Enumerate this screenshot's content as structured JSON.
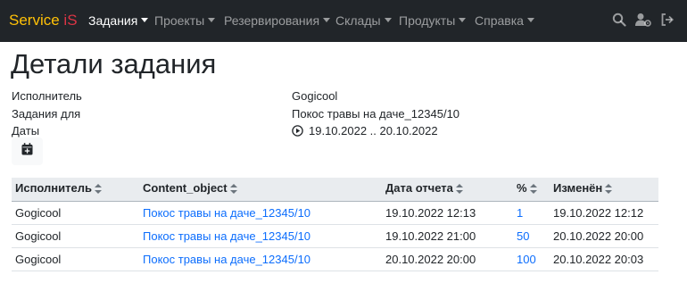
{
  "navbar": {
    "brand_part1": "Service",
    "brand_part2": "iS",
    "menu": [
      {
        "label": "Задания"
      },
      {
        "label": "Проекты"
      },
      {
        "label": "Резервирования"
      },
      {
        "label": "Склады"
      },
      {
        "label": "Продукты"
      },
      {
        "label": "Справка"
      }
    ],
    "icons": [
      "search-icon",
      "user-settings-icon",
      "logout-icon"
    ]
  },
  "page": {
    "title": "Детали задания"
  },
  "details": {
    "executor_label": "Исполнитель",
    "executor_value": "Gogicool",
    "task_for_label": "Задания для",
    "task_for_value": "Покос травы на даче_12345/10",
    "dates_label": "Даты",
    "dates_value": "19.10.2022 .. 20.10.2022",
    "calendar_icon": "calendar-add-icon"
  },
  "table": {
    "headers": [
      "Исполнитель",
      "Content_object",
      "Дата отчета",
      "%",
      "Изменён"
    ],
    "rows": [
      [
        "Gogicool",
        "Покос травы на даче_12345/10",
        "19.10.2022 12:13",
        "1",
        "19.10.2022 12:12"
      ],
      [
        "Gogicool",
        "Покос травы на даче_12345/10",
        "19.10.2022 21:00",
        "50",
        "20.10.2022 20:00"
      ],
      [
        "Gogicool",
        "Покос травы на даче_12345/10",
        "20.10.2022 20:00",
        "100",
        "20.10.2022 20:03"
      ]
    ]
  },
  "colors": {
    "navbar_bg": "#212529",
    "brand_yellow": "#ffc107",
    "brand_red": "#dc3545",
    "link": "#0d6efd",
    "table_header_bg": "#e9ecef"
  }
}
